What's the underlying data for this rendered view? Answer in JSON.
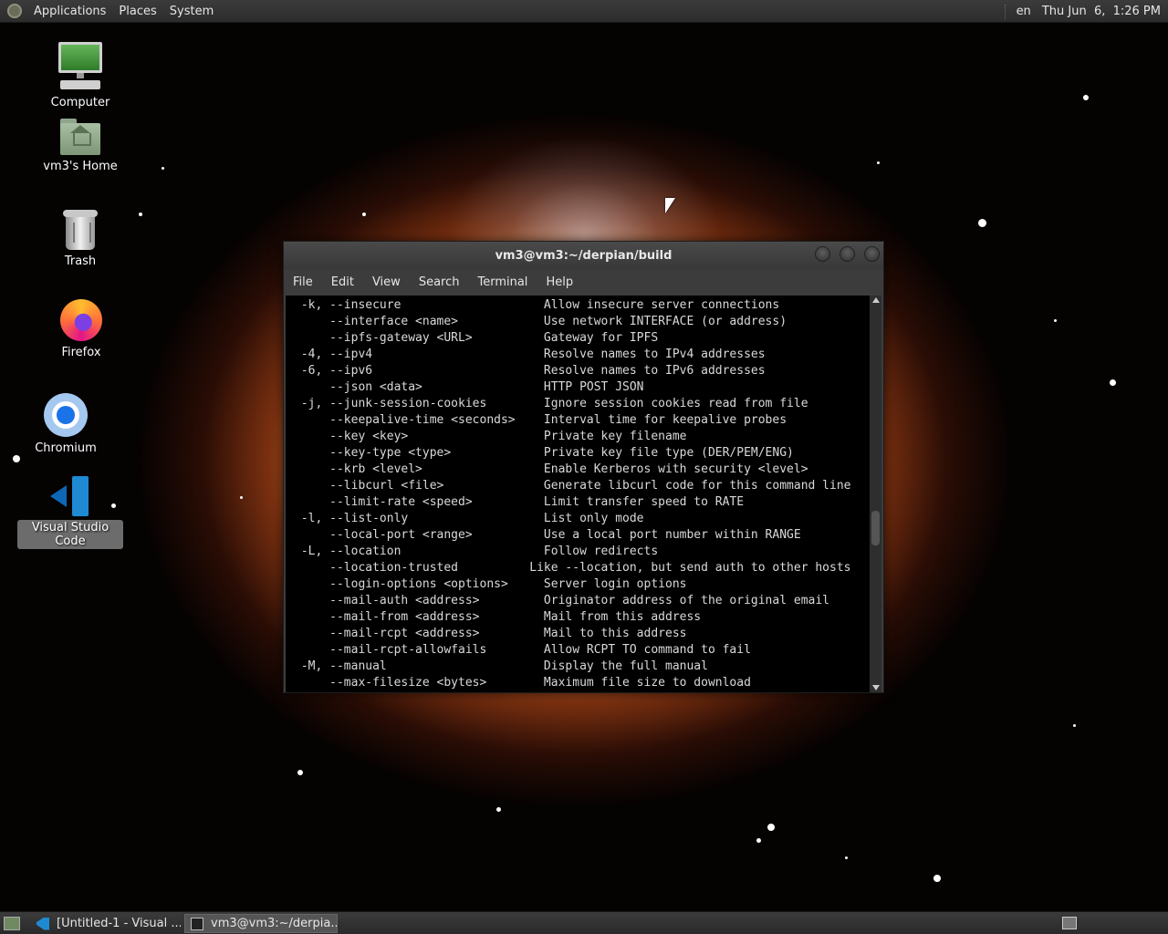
{
  "top_panel": {
    "menus": [
      "Applications",
      "Places",
      "System"
    ],
    "language": "en",
    "clock": "Thu Jun  6,  1:26 PM"
  },
  "desktop_icons": {
    "computer": "Computer",
    "home": "vm3's Home",
    "trash": "Trash",
    "firefox": "Firefox",
    "chromium": "Chromium",
    "vscode": "Visual Studio Code"
  },
  "terminal": {
    "title": "vm3@vm3:~/derpian/build",
    "menus": [
      "File",
      "Edit",
      "View",
      "Search",
      "Terminal",
      "Help"
    ],
    "lines": [
      " -k, --insecure                    Allow insecure server connections",
      "     --interface <name>            Use network INTERFACE (or address)",
      "     --ipfs-gateway <URL>          Gateway for IPFS",
      " -4, --ipv4                        Resolve names to IPv4 addresses",
      " -6, --ipv6                        Resolve names to IPv6 addresses",
      "     --json <data>                 HTTP POST JSON",
      " -j, --junk-session-cookies        Ignore session cookies read from file",
      "     --keepalive-time <seconds>    Interval time for keepalive probes",
      "     --key <key>                   Private key filename",
      "     --key-type <type>             Private key file type (DER/PEM/ENG)",
      "     --krb <level>                 Enable Kerberos with security <level>",
      "     --libcurl <file>              Generate libcurl code for this command line",
      "     --limit-rate <speed>          Limit transfer speed to RATE",
      " -l, --list-only                   List only mode",
      "     --local-port <range>          Use a local port number within RANGE",
      " -L, --location                    Follow redirects",
      "     --location-trusted          Like --location, but send auth to other hosts",
      "     --login-options <options>     Server login options",
      "     --mail-auth <address>         Originator address of the original email",
      "     --mail-from <address>         Mail from this address",
      "     --mail-rcpt <address>         Mail to this address",
      "     --mail-rcpt-allowfails        Allow RCPT TO command to fail",
      " -M, --manual                      Display the full manual",
      "     --max-filesize <bytes>        Maximum file size to download"
    ]
  },
  "taskbar": {
    "tasks": [
      "[Untitled-1 - Visual ...",
      "vm3@vm3:~/derpia..."
    ]
  }
}
